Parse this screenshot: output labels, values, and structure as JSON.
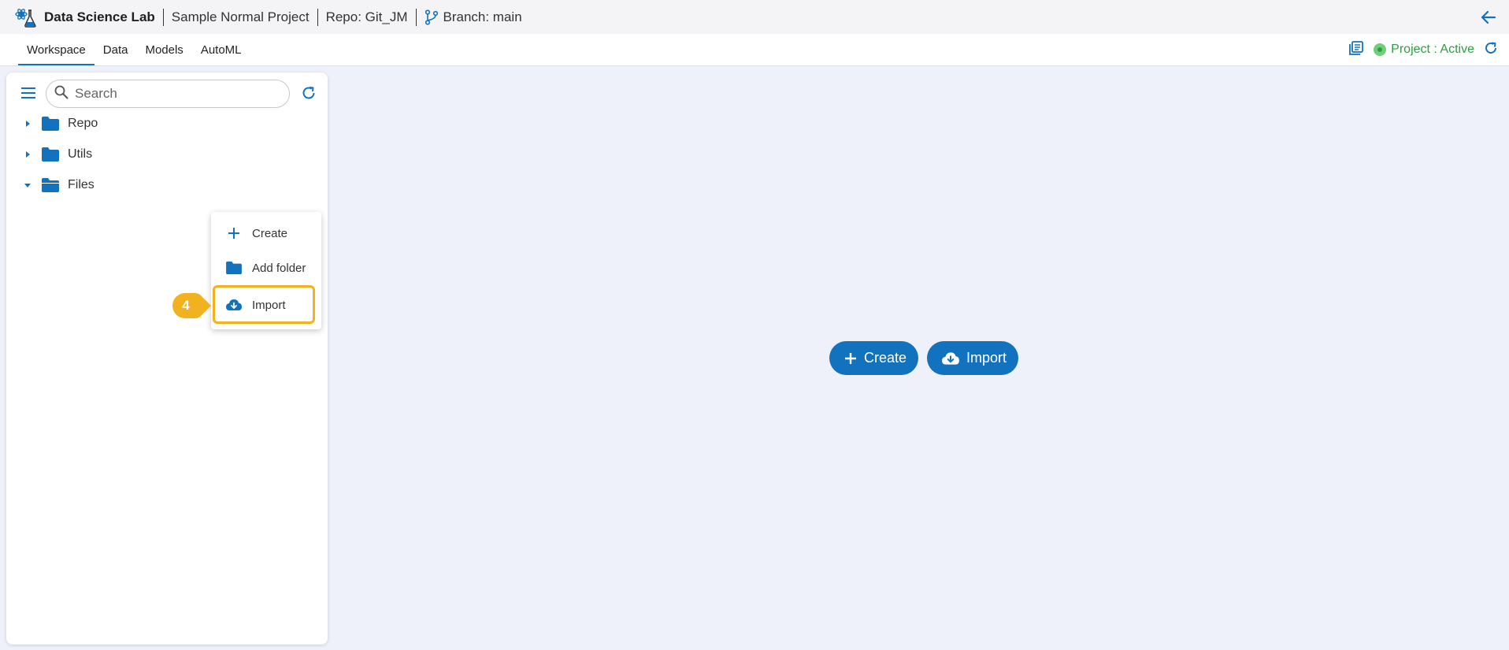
{
  "header": {
    "app_title": "Data Science Lab",
    "project": "Sample Normal Project",
    "repo": "Repo: Git_JM",
    "branch": "Branch: main"
  },
  "tabs": [
    {
      "label": "Workspace",
      "active": true
    },
    {
      "label": "Data",
      "active": false
    },
    {
      "label": "Models",
      "active": false
    },
    {
      "label": "AutoML",
      "active": false
    }
  ],
  "project_status": {
    "label": "Project : Active",
    "color": "#2e9e44"
  },
  "sidebar": {
    "search_placeholder": "Search",
    "tree": [
      {
        "label": "Repo",
        "expanded": false
      },
      {
        "label": "Utils",
        "expanded": false
      },
      {
        "label": "Files",
        "expanded": true
      }
    ]
  },
  "context_menu": {
    "items": [
      {
        "label": "Create",
        "icon": "plus-icon"
      },
      {
        "label": "Add folder",
        "icon": "folder-icon"
      },
      {
        "label": "Import",
        "icon": "cloud-download-icon"
      }
    ]
  },
  "step_badge": "4",
  "main": {
    "create_label": "Create",
    "import_label": "Import"
  },
  "colors": {
    "accent": "#1272be",
    "highlight": "#f2b21d",
    "background": "#eef1f9"
  }
}
